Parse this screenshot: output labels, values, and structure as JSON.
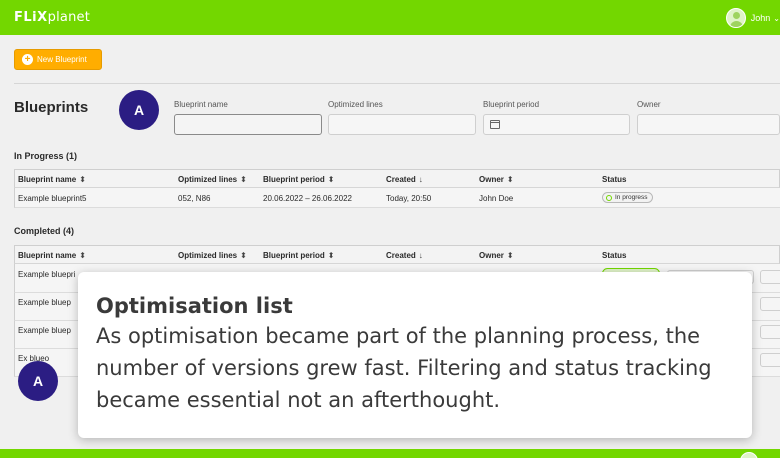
{
  "topbar": {
    "logo_bold": "FLiX",
    "logo_light": "planet",
    "user_name": "John",
    "user_caret": "⌵"
  },
  "actions": {
    "new_blueprint_label": "New Blueprint"
  },
  "page": {
    "title": "Blueprints",
    "badge_letter": "A"
  },
  "filters": {
    "blueprint_name_label": "Blueprint name",
    "optimized_lines_label": "Optimized lines",
    "blueprint_period_label": "Blueprint period",
    "owner_label": "Owner"
  },
  "columns": {
    "name": "Blueprint name",
    "lines": "Optimized lines",
    "period": "Blueprint period",
    "created": "Created",
    "owner": "Owner",
    "status": "Status"
  },
  "sort_icons": {
    "updown": "⬍",
    "down": "↓"
  },
  "in_progress": {
    "heading": "In Progress (1)",
    "rows": [
      {
        "name": "Example blueprint5",
        "lines": "052, N86",
        "period": "20.06.2022 – 26.06.2022",
        "created": "Today, 20:50",
        "owner": "John Doe",
        "status": "In progress"
      }
    ]
  },
  "completed": {
    "heading": "Completed (4)",
    "rows": [
      {
        "name": "Example bluepri"
      },
      {
        "name": "Example bluep"
      },
      {
        "name": "Example bluep"
      },
      {
        "name": "Ex      blueo"
      }
    ]
  },
  "callout": {
    "title": "Optimisation list",
    "body": "As optimisation became part of the planning process, the number of versions grew fast. Filtering and status tracking became essential not an afterthought."
  },
  "colors": {
    "brand_green": "#73d700",
    "accent_orange": "#ffad00",
    "badge_navy": "#2b1d83"
  },
  "icons": {
    "plus": "+",
    "user": "avatar-icon",
    "calendar": "calendar-icon"
  }
}
